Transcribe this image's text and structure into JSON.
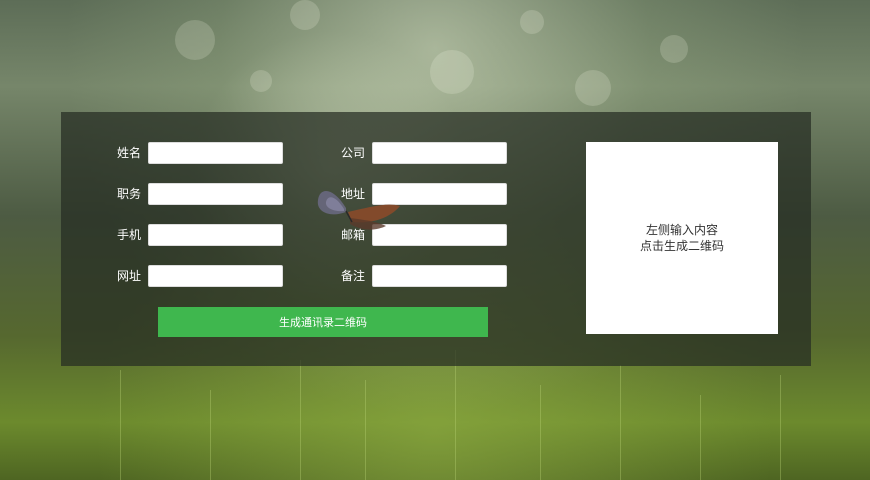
{
  "form": {
    "fields": [
      {
        "label": "姓名",
        "value": "",
        "placeholder": ""
      },
      {
        "label": "公司",
        "value": "",
        "placeholder": ""
      },
      {
        "label": "职务",
        "value": "",
        "placeholder": ""
      },
      {
        "label": "地址",
        "value": "",
        "placeholder": ""
      },
      {
        "label": "手机",
        "value": "",
        "placeholder": ""
      },
      {
        "label": "邮箱",
        "value": "",
        "placeholder": ""
      },
      {
        "label": "网址",
        "value": "",
        "placeholder": ""
      },
      {
        "label": "备注",
        "value": "",
        "placeholder": ""
      }
    ],
    "submit_label": "生成通讯录二维码"
  },
  "preview": {
    "line1": "左侧输入内容",
    "line2": "点击生成二维码"
  },
  "colors": {
    "accent": "#3fb74e",
    "panel_bg": "rgba(38,44,34,0.72)"
  }
}
